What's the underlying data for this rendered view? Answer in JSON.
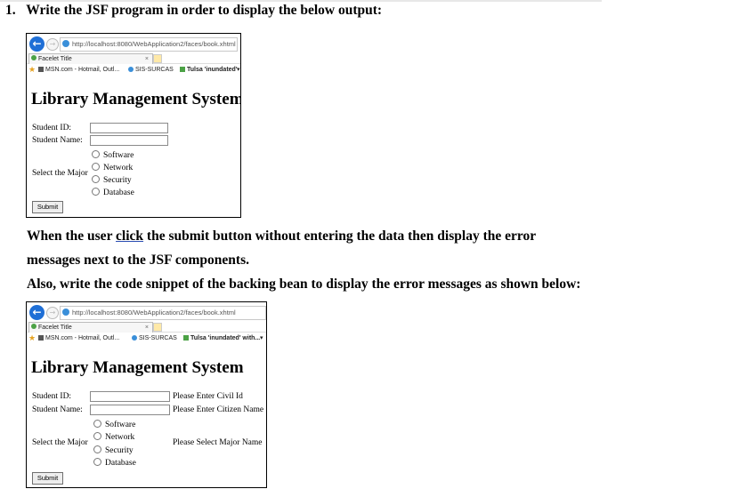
{
  "question": {
    "number_title": "1.   Write the JSF program in order to display the below output:",
    "para1_before": "When the user ",
    "para1_click": "click",
    "para1_after": " the submit button without entering the data then display the error",
    "para2": "messages next to the JSF components.",
    "para3": "Also, write the code snippet of the backing bean to display the error messages as shown below:"
  },
  "browser": {
    "back_glyph": "←",
    "fwd_glyph": "→",
    "url": "http://localhost:8080/WebApplication2/faces/book.xhtml",
    "tab_title": "Facelet Title",
    "tab_close": "×",
    "star_glyph": "★",
    "favorites": [
      "MSN.com - Hotmail, Outl...",
      "SIS-SURCAS",
      "Tulsa 'inundated'"
    ],
    "favorites_shot2_last": "Tulsa 'inundated' with...",
    "fav_more": "▾"
  },
  "form": {
    "title": "Library Management System",
    "student_id_label": "Student ID:",
    "student_id_label_2": "Student ID:",
    "student_name_label": "Student Name:",
    "major_label": "Select the Major",
    "majors": [
      "Software",
      "Network",
      "Security",
      "Database"
    ],
    "submit_label": "Submit"
  },
  "errors": {
    "civil_id": "Please Enter Civil Id",
    "citizen_name": "Please Enter Citizen Name",
    "major": "Please Select Major Name"
  }
}
